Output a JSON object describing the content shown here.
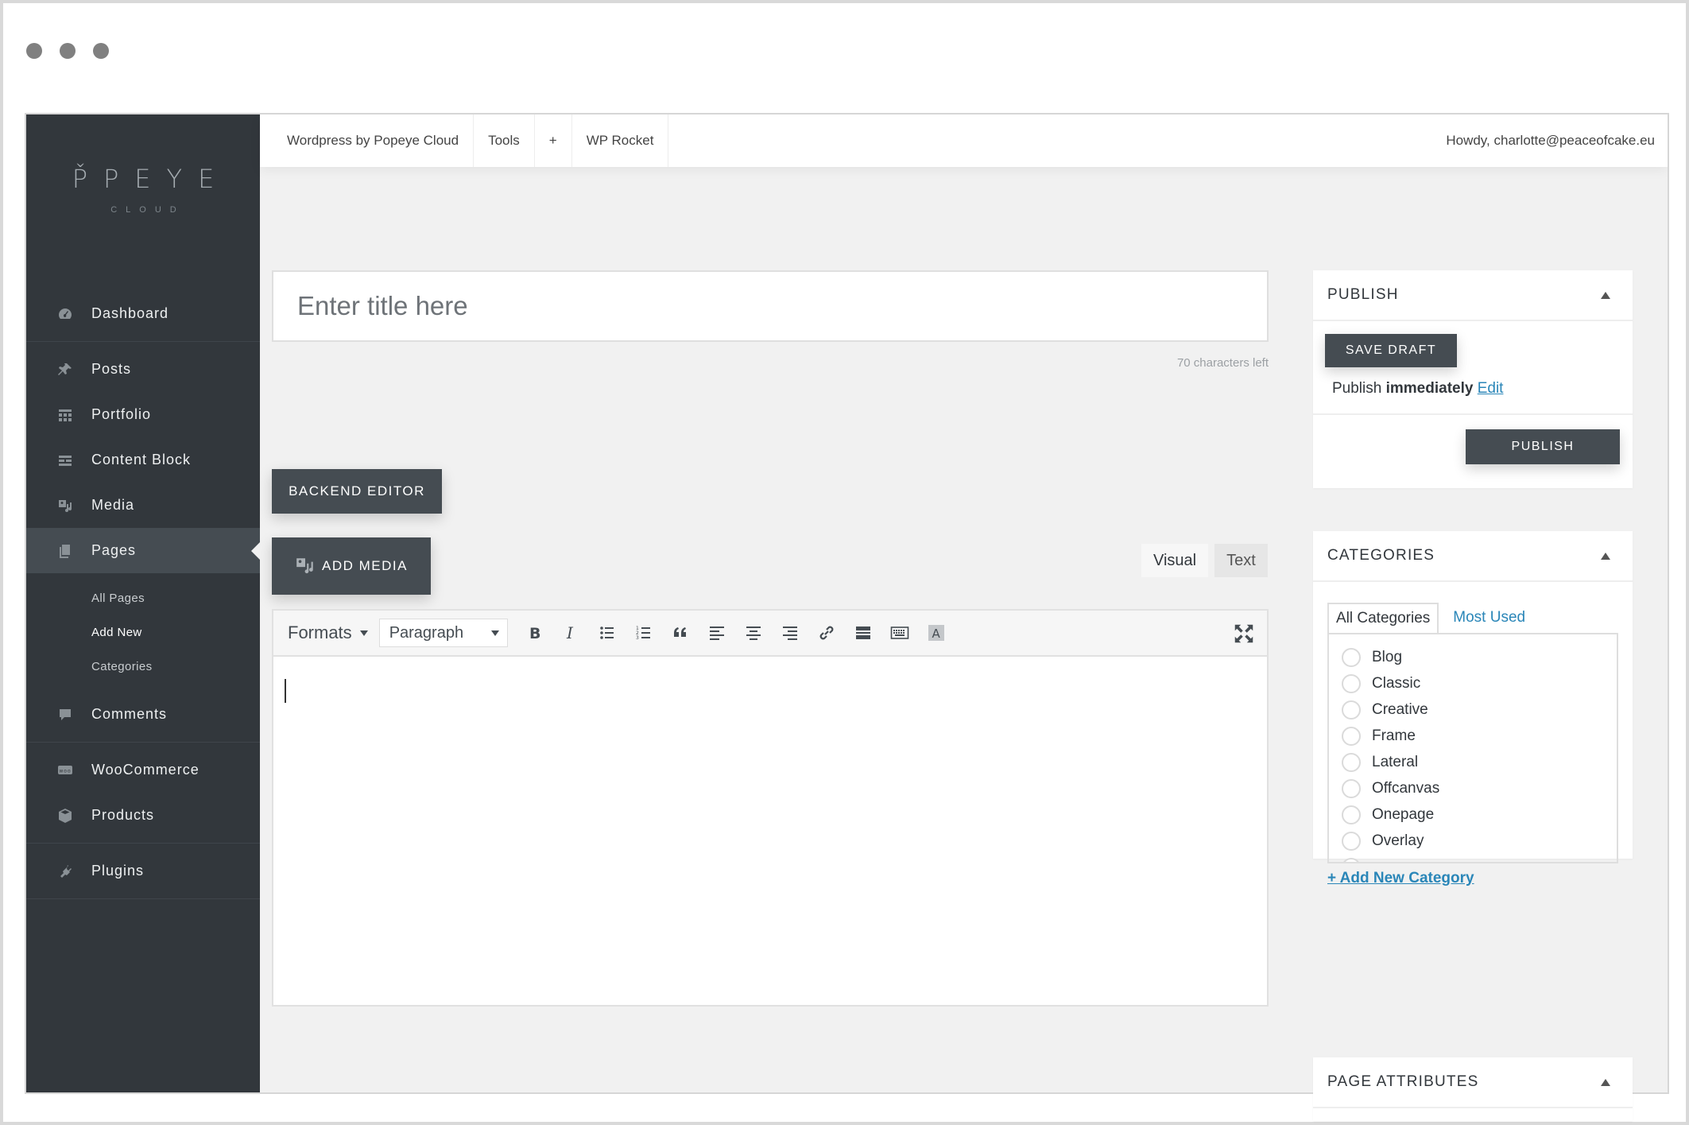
{
  "browser": {
    "controls": [
      "close",
      "minimize",
      "maximize"
    ]
  },
  "logo": {
    "main": "P̌PEYE",
    "sub": "CLOUD"
  },
  "sidebar": {
    "items": [
      {
        "label": "Dashboard",
        "icon": "dashboard-icon"
      },
      {
        "label": "Posts",
        "icon": "pin-icon"
      },
      {
        "label": "Portfolio",
        "icon": "grid-icon"
      },
      {
        "label": "Content Block",
        "icon": "blocks-icon"
      },
      {
        "label": "Media",
        "icon": "media-icon"
      },
      {
        "label": "Pages",
        "icon": "pages-icon"
      },
      {
        "label": "Comments",
        "icon": "comment-icon"
      },
      {
        "label": "WooCommerce",
        "icon": "woo-icon"
      },
      {
        "label": "Products",
        "icon": "box-icon"
      },
      {
        "label": "Plugins",
        "icon": "plugin-icon"
      }
    ],
    "submenu": [
      "All Pages",
      "Add New",
      "Categories"
    ]
  },
  "topbar": {
    "items": [
      "Wordpress by Popeye Cloud",
      "Tools",
      "+",
      "WP Rocket"
    ],
    "greeting": "Howdy, charlotte@peaceofcake.eu"
  },
  "editor": {
    "title_placeholder": "Enter title here",
    "chars_left": "70 characters left",
    "backend_button": "BACKEND EDITOR",
    "add_media": "ADD MEDIA",
    "tabs": {
      "visual": "Visual",
      "text": "Text"
    },
    "formats": "Formats",
    "paragraph": "Paragraph",
    "tools": [
      "bold-icon",
      "italic-icon",
      "bullet-list-icon",
      "numbered-list-icon",
      "blockquote-icon",
      "align-left-icon",
      "align-center-icon",
      "align-right-icon",
      "link-icon",
      "read-more-icon",
      "keyboard-icon",
      "text-color-icon",
      "fullscreen-icon"
    ]
  },
  "publish": {
    "title": "PUBLISH",
    "save_draft": "SAVE DRAFT",
    "status_prefix": "Publish",
    "status_value": "immediately",
    "edit": "Edit",
    "publish_button": "PUBLISH"
  },
  "categories": {
    "title": "CATEGORIES",
    "tab_all": "All Categories",
    "tab_used": "Most Used",
    "items": [
      "Blog",
      "Classic",
      "Creative",
      "Frame",
      "Lateral",
      "Offcanvas",
      "Onepage",
      "Overlay"
    ],
    "add_new": "+ Add New Category"
  },
  "page_attributes": {
    "title": "PAGE ATTRIBUTES"
  },
  "colors": {
    "sidebar": "#32373c",
    "button": "#454c52",
    "link": "#2a86b8",
    "background": "#f1f1f1"
  }
}
